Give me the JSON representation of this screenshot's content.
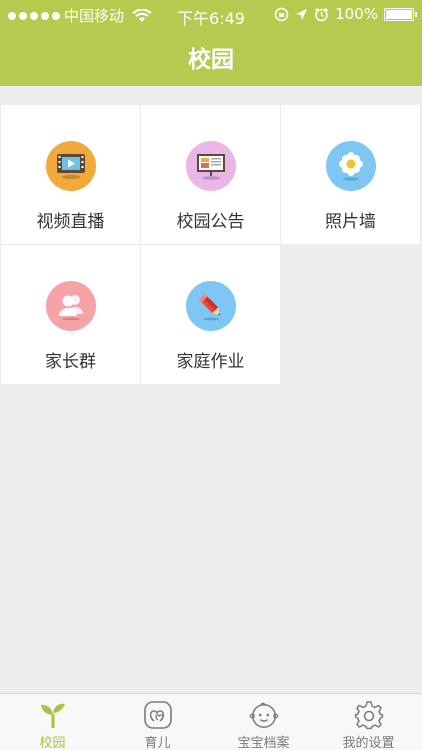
{
  "status_bar": {
    "carrier": "中国移动",
    "time": "下午6:49",
    "battery": "100%",
    "battery_level": 1.0
  },
  "header": {
    "title": "校园"
  },
  "tiles": [
    {
      "label": "视频直播",
      "icon": "video-icon",
      "color": "#f2a93b"
    },
    {
      "label": "校园公告",
      "icon": "board-icon",
      "color": "#e9b6e5"
    },
    {
      "label": "照片墙",
      "icon": "flower-icon",
      "color": "#7ec7f2"
    },
    {
      "label": "家长群",
      "icon": "group-icon",
      "color": "#f6a3a8"
    },
    {
      "label": "家庭作业",
      "icon": "pencil-icon",
      "color": "#7ec7f2"
    }
  ],
  "tabbar": {
    "items": [
      {
        "label": "校园",
        "icon": "sprout-icon",
        "active": true
      },
      {
        "label": "育儿",
        "icon": "heart-icon",
        "active": false
      },
      {
        "label": "宝宝档案",
        "icon": "baby-face-icon",
        "active": false
      },
      {
        "label": "我的设置",
        "icon": "gear-icon",
        "active": false
      }
    ]
  },
  "colors": {
    "header": "#b5cb4f",
    "active_tab": "#a9c242",
    "background": "#ededed"
  }
}
